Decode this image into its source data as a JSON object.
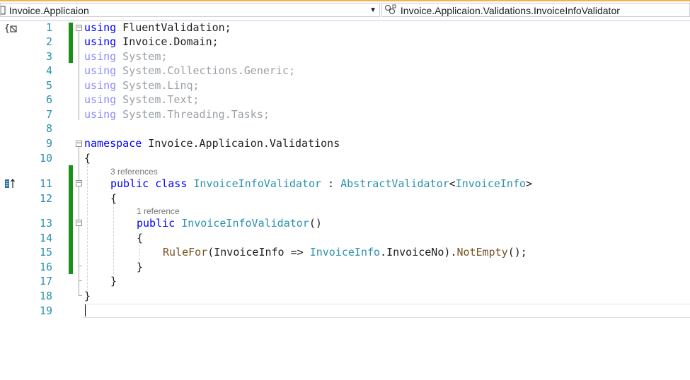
{
  "navigation_bar": {
    "project_dropdown": {
      "label": "Invoice.Applicaion",
      "icon": "csharp-project-icon"
    },
    "type_dropdown": {
      "label": "Invoice.Applicaion.Validations.InvoiceInfoValidator",
      "icon": "class-icon"
    }
  },
  "margin_icons": {
    "using_fold_icon": "{ ⊠",
    "override_icon": "⤒"
  },
  "line_numbers": [
    "1",
    "2",
    "3",
    "4",
    "5",
    "6",
    "7",
    "8",
    "9",
    "10",
    "11",
    "12",
    "13",
    "14",
    "15",
    "16",
    "17",
    "18",
    "19"
  ],
  "code": {
    "l1": {
      "kw": "using",
      "rest": " FluentValidation;"
    },
    "l2": {
      "kw": "using",
      "rest": " Invoice.Domain;"
    },
    "l3": {
      "kw": "using",
      "rest": " System;"
    },
    "l4": {
      "kw": "using",
      "rest": " System.Collections.Generic;"
    },
    "l5": {
      "kw": "using",
      "rest": " System.Linq;"
    },
    "l6": {
      "kw": "using",
      "rest": " System.Text;"
    },
    "l7": {
      "kw": "using",
      "rest": " System.Threading.Tasks;"
    },
    "l9": {
      "kw": "namespace",
      "rest": " Invoice.Applicaion.Validations"
    },
    "l10": "{",
    "lens_class": "3 references",
    "l11": {
      "kw1": "public",
      "kw2": "class",
      "type1": "InvoiceInfoValidator",
      "sep": " : ",
      "type2": "AbstractValidator",
      "lt": "<",
      "type3": "InvoiceInfo",
      "gt": ">"
    },
    "l12": "{",
    "lens_ctor": "1 reference",
    "l13": {
      "kw": "public",
      "type": "InvoiceInfoValidator",
      "rest": "()"
    },
    "l14": "{",
    "l15": {
      "m1": "RuleFor",
      "p1": "(InvoiceInfo => ",
      "t1": "InvoiceInfo",
      ".": ".",
      "p2": "InvoiceNo).",
      "m2": "NotEmpty",
      "p3": "();"
    },
    "l16": "}",
    "l17": "}",
    "l18": "}"
  }
}
